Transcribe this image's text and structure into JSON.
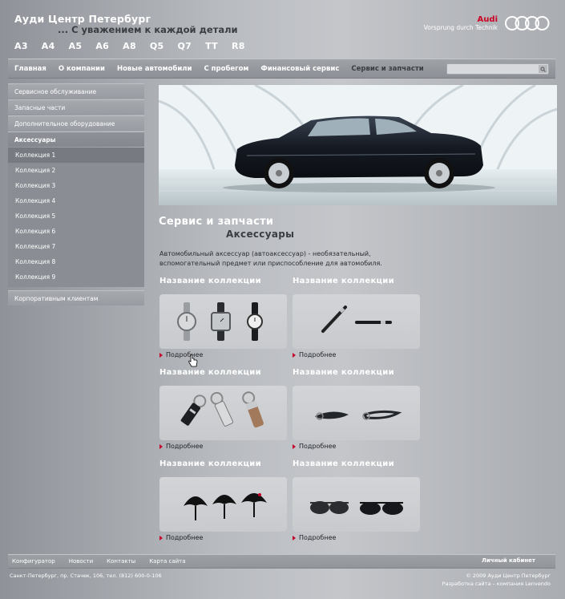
{
  "header": {
    "site_title": "Ауди Центр Петербург",
    "slogan": "... С уважением к каждой детали",
    "brand_name": "Audi",
    "brand_motto": "Vorsprung durch Technik",
    "accent_color": "#cc0022"
  },
  "models": [
    "A3",
    "A4",
    "A5",
    "A6",
    "A8",
    "Q5",
    "Q7",
    "TT",
    "R8"
  ],
  "topnav": {
    "items": [
      "Главная",
      "О компании",
      "Новые автомобили",
      "С пробегом",
      "Финансовый сервис",
      "Сервис и запчасти"
    ],
    "active_index": 5,
    "search_placeholder": "",
    "search_icon": "magnifier-icon"
  },
  "sidebar": {
    "items": [
      "Сервисное обслуживание",
      "Запасные части",
      "Дополнительное оборудование",
      "Аксессуары"
    ],
    "active_label": "Аксессуары",
    "sub_items": [
      "Коллекция 1",
      "Коллекция 2",
      "Коллекция 3",
      "Коллекция 4",
      "Коллекция 5",
      "Коллекция 6",
      "Коллекция 7",
      "Коллекция 8",
      "Коллекция 9"
    ],
    "current_sub_index": 0,
    "bottom_item": "Корпоративным клиентам"
  },
  "main": {
    "heading": "Сервис и запчасти",
    "subheading": "Аксессуары",
    "intro": "Автомобильный аксессуар (автоаксессуар) - необязательный, вспомогательный предмет или приспособление для автомобиля.",
    "collections": [
      {
        "title": "Название коллекции",
        "more": "Подробнее",
        "image": "watches"
      },
      {
        "title": "Название коллекции",
        "more": "Подробнее",
        "image": "pens"
      },
      {
        "title": "Название коллекции",
        "more": "Подробнее",
        "image": "keychains"
      },
      {
        "title": "Название коллекции",
        "more": "Подробнее",
        "image": "lanyards"
      },
      {
        "title": "Название коллекции",
        "more": "Подробнее",
        "image": "umbrellas"
      },
      {
        "title": "Название коллекции",
        "more": "Подробнее",
        "image": "sunglasses"
      }
    ]
  },
  "footer": {
    "links": [
      "Конфигуратор",
      "Новости",
      "Контакты",
      "Карта сайта"
    ],
    "cabinet": "Личный кабинет",
    "address": "Санкт-Петербург, пр. Стачек, 106, тел. (812) 600-0-106",
    "copyright": "© 2009 Ауди Центр Петербург",
    "developer": "Разработка сайта – компания Lenvendo"
  }
}
